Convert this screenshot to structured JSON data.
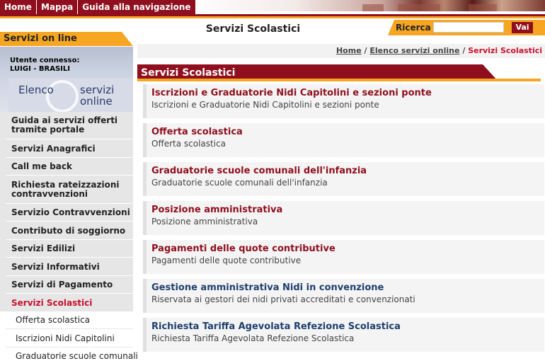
{
  "top_nav": {
    "items": [
      "Home",
      "Mappa",
      "Guida alla navigazione"
    ]
  },
  "header": {
    "title": "Servizi Scolastici"
  },
  "search": {
    "label": "Ricerca",
    "value": "",
    "button": "Vai"
  },
  "sidebar": {
    "title": "Servizi on line",
    "user_label": "Utente connesso:",
    "user_name": "LUIGI - BRASILI",
    "elenco_line1": "Elenco",
    "elenco_line2": "servizi",
    "elenco_line3": "online",
    "items": [
      "Guida ai servizi offerti tramite portale",
      "Servizi Anagrafici",
      "Call me back",
      "Richiesta rateizzazioni contravvenzioni",
      "Servizio Contravvenzioni",
      "Contributo di soggiorno",
      "Servizi Edilizi",
      "Servizi Informativi",
      "Servizi di Pagamento",
      "Servizi Scolastici"
    ],
    "active_item": "Servizi Scolastici",
    "subitems": [
      "Offerta scolastica",
      "Iscrizioni Nidi Capitolini",
      "Graduatorie scuole comunali"
    ]
  },
  "breadcrumb": {
    "home": "Home",
    "sep": "/",
    "list": "Elenco servizi online",
    "current": "Servizi Scolastici"
  },
  "section": {
    "title": "Servizi Scolastici"
  },
  "services": [
    {
      "title": "Iscrizioni e Graduatorie Nidi Capitolini e sezioni ponte",
      "desc": "Iscrizioni e Graduatorie Nidi Capitolini e sezioni ponte",
      "color": "red"
    },
    {
      "title": "Offerta scolastica",
      "desc": "Offerta scolastica",
      "color": "red"
    },
    {
      "title": "Graduatorie scuole comunali dell'infanzia",
      "desc": "Graduatorie scuole comunali dell'infanzia",
      "color": "red"
    },
    {
      "title": "Posizione amministrativa",
      "desc": "Posizione amministrativa",
      "color": "red"
    },
    {
      "title": "Pagamenti delle quote contributive",
      "desc": "Pagamenti delle quote contributive",
      "color": "red"
    },
    {
      "title": "Gestione amministrativa Nidi in convenzione",
      "desc": "Riservata ai gestori dei nidi privati accreditati e convenzionati",
      "color": "blue"
    },
    {
      "title": "Richiesta Tariffa Agevolata Refezione Scolastica",
      "desc": "Richiesta Tariffa Agevolata Refezione Scolastica",
      "color": "blue"
    }
  ],
  "colors": {
    "brand_red": "#8f0f1e",
    "accent_orange": "#f6a623",
    "active_red": "#c8102e",
    "link_blue": "#1f3f6f"
  }
}
